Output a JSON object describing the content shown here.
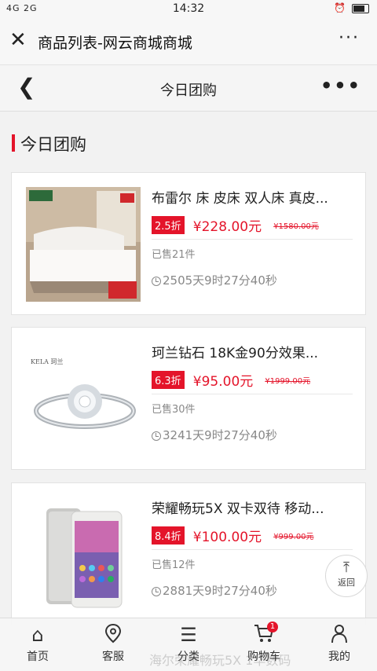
{
  "status": {
    "signal": "4G 2G",
    "time": "14:32",
    "icons": "alarm wifi-call battery"
  },
  "titlebar": {
    "title": "商品列表-网云商城商城",
    "more": "···"
  },
  "page": {
    "title": "今日团购",
    "more": "•••"
  },
  "section": {
    "title": "今日团购"
  },
  "products": [
    {
      "name": "布雷尔 床 皮床 双人床 真皮...",
      "discount": "2.5折",
      "price": "¥228.00元",
      "old_price": "¥1580.00元",
      "sold": "已售21件",
      "countdown": "2505天9时27分40秒"
    },
    {
      "name": "珂兰钻石 18K金90分效果...",
      "discount": "6.3折",
      "price": "¥95.00元",
      "old_price": "¥1999.00元",
      "sold": "已售30件",
      "countdown": "3241天9时27分40秒"
    },
    {
      "name": "荣耀畅玩5X 双卡双待 移动...",
      "discount": "8.4折",
      "price": "¥100.00元",
      "old_price": "¥999.00元",
      "sold": "已售12件",
      "countdown": "2881天9时27分40秒"
    }
  ],
  "to_top": {
    "label": "返回"
  },
  "nav": [
    {
      "label": "首页",
      "icon": "home-icon"
    },
    {
      "label": "客服",
      "icon": "location-icon"
    },
    {
      "label": "分类",
      "icon": "list-icon"
    },
    {
      "label": "购物车",
      "icon": "cart-icon",
      "badge": "1"
    },
    {
      "label": "我的",
      "icon": "user-icon"
    }
  ],
  "ghost_text": "海尔荣耀畅玩5X 1华数码",
  "colors": {
    "accent": "#e4142a",
    "background": "#f2f2f2"
  }
}
